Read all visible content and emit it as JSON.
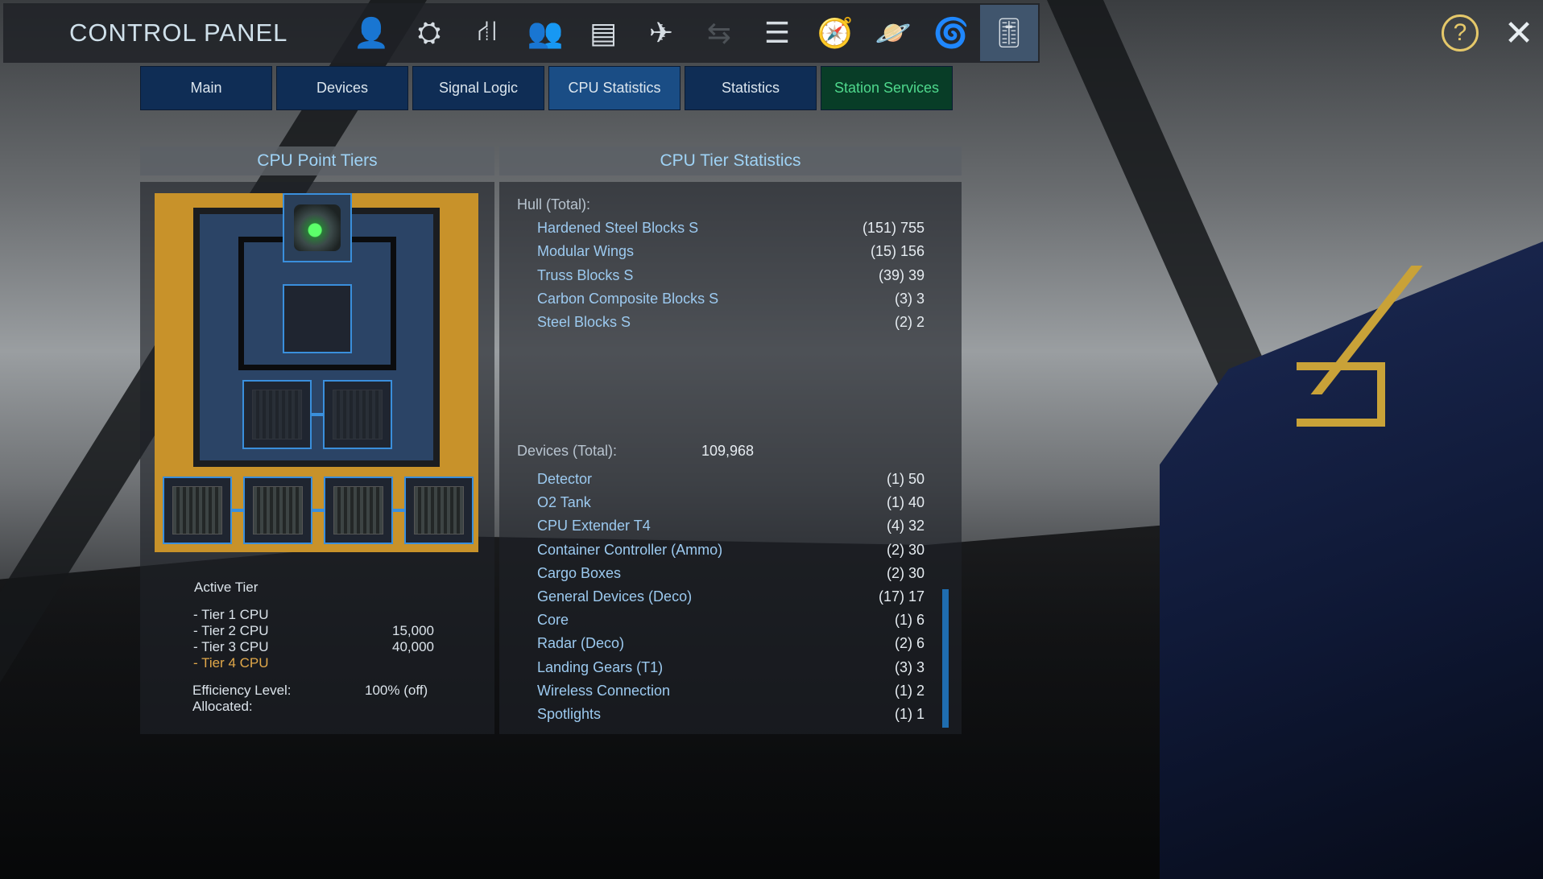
{
  "window": {
    "title": "CONTROL PANEL"
  },
  "top_icons": [
    {
      "name": "player-icon",
      "glyph": "👤",
      "state": "normal"
    },
    {
      "name": "structure-icon",
      "glyph": "⛭",
      "state": "normal"
    },
    {
      "name": "hierarchy-icon",
      "glyph": "⛙",
      "state": "normal"
    },
    {
      "name": "group-icon",
      "glyph": "👥",
      "state": "normal"
    },
    {
      "name": "window-icon",
      "glyph": "▤",
      "state": "normal"
    },
    {
      "name": "ship-icon",
      "glyph": "✈",
      "state": "normal"
    },
    {
      "name": "transfer-icon",
      "glyph": "⇆",
      "state": "dim"
    },
    {
      "name": "list-icon",
      "glyph": "☰",
      "state": "normal"
    },
    {
      "name": "compass-icon",
      "glyph": "🧭",
      "state": "normal"
    },
    {
      "name": "planet-icon",
      "glyph": "🪐",
      "state": "normal"
    },
    {
      "name": "galaxy-icon",
      "glyph": "🌀",
      "state": "normal"
    },
    {
      "name": "settings-sliders-icon",
      "glyph": "🎚",
      "state": "active"
    }
  ],
  "help_label": "?",
  "close_label": "✕",
  "tabs": [
    "Main",
    "Devices",
    "Signal Logic",
    "CPU Statistics",
    "Statistics",
    "Station Services"
  ],
  "left_panel": {
    "title": "CPU Point Tiers",
    "active_tier_label": "Active Tier",
    "tiers": [
      {
        "label": "- Tier 1 CPU",
        "value": ""
      },
      {
        "label": "- Tier 2 CPU",
        "value": "15,000"
      },
      {
        "label": "- Tier 3 CPU",
        "value": "40,000"
      },
      {
        "label": "- Tier 4 CPU",
        "value": ""
      }
    ],
    "efficiency_label": "Efficiency Level:",
    "efficiency_value": "100% (off)",
    "allocated_label": "Allocated:"
  },
  "right_panel": {
    "title": "CPU Tier Statistics",
    "hull_label": "Hull (Total):",
    "hull_items": [
      {
        "name": "Hardened Steel Blocks S",
        "value": "(151) 755"
      },
      {
        "name": "Modular Wings",
        "value": "(15) 156"
      },
      {
        "name": "Truss Blocks S",
        "value": "(39) 39"
      },
      {
        "name": "Carbon Composite Blocks S",
        "value": "(3) 3"
      },
      {
        "name": "Steel Blocks S",
        "value": "(2) 2"
      }
    ],
    "devices_label": "Devices (Total):",
    "devices_total": "109,968",
    "device_items": [
      {
        "name": "Detector",
        "value": "(1) 50"
      },
      {
        "name": "O2 Tank",
        "value": "(1) 40"
      },
      {
        "name": "CPU Extender T4",
        "value": "(4) 32"
      },
      {
        "name": "Container Controller (Ammo)",
        "value": "(2) 30"
      },
      {
        "name": "Cargo Boxes",
        "value": "(2) 30"
      },
      {
        "name": "General Devices (Deco)",
        "value": "(17) 17"
      },
      {
        "name": "Core",
        "value": "(1) 6"
      },
      {
        "name": "Radar (Deco)",
        "value": "(2) 6"
      },
      {
        "name": "Landing Gears (T1)",
        "value": "(3) 3"
      },
      {
        "name": "Wireless Connection",
        "value": "(1) 2"
      },
      {
        "name": "Spotlights",
        "value": "(1) 1"
      }
    ]
  },
  "colors": {
    "tab_bg": "#0f2d55",
    "tab_active": "#1a4d85",
    "station_green": "#4fd98d",
    "gold": "#c8922a",
    "slot_border": "#3a8fdc",
    "tier_active": "#e1a84a"
  }
}
